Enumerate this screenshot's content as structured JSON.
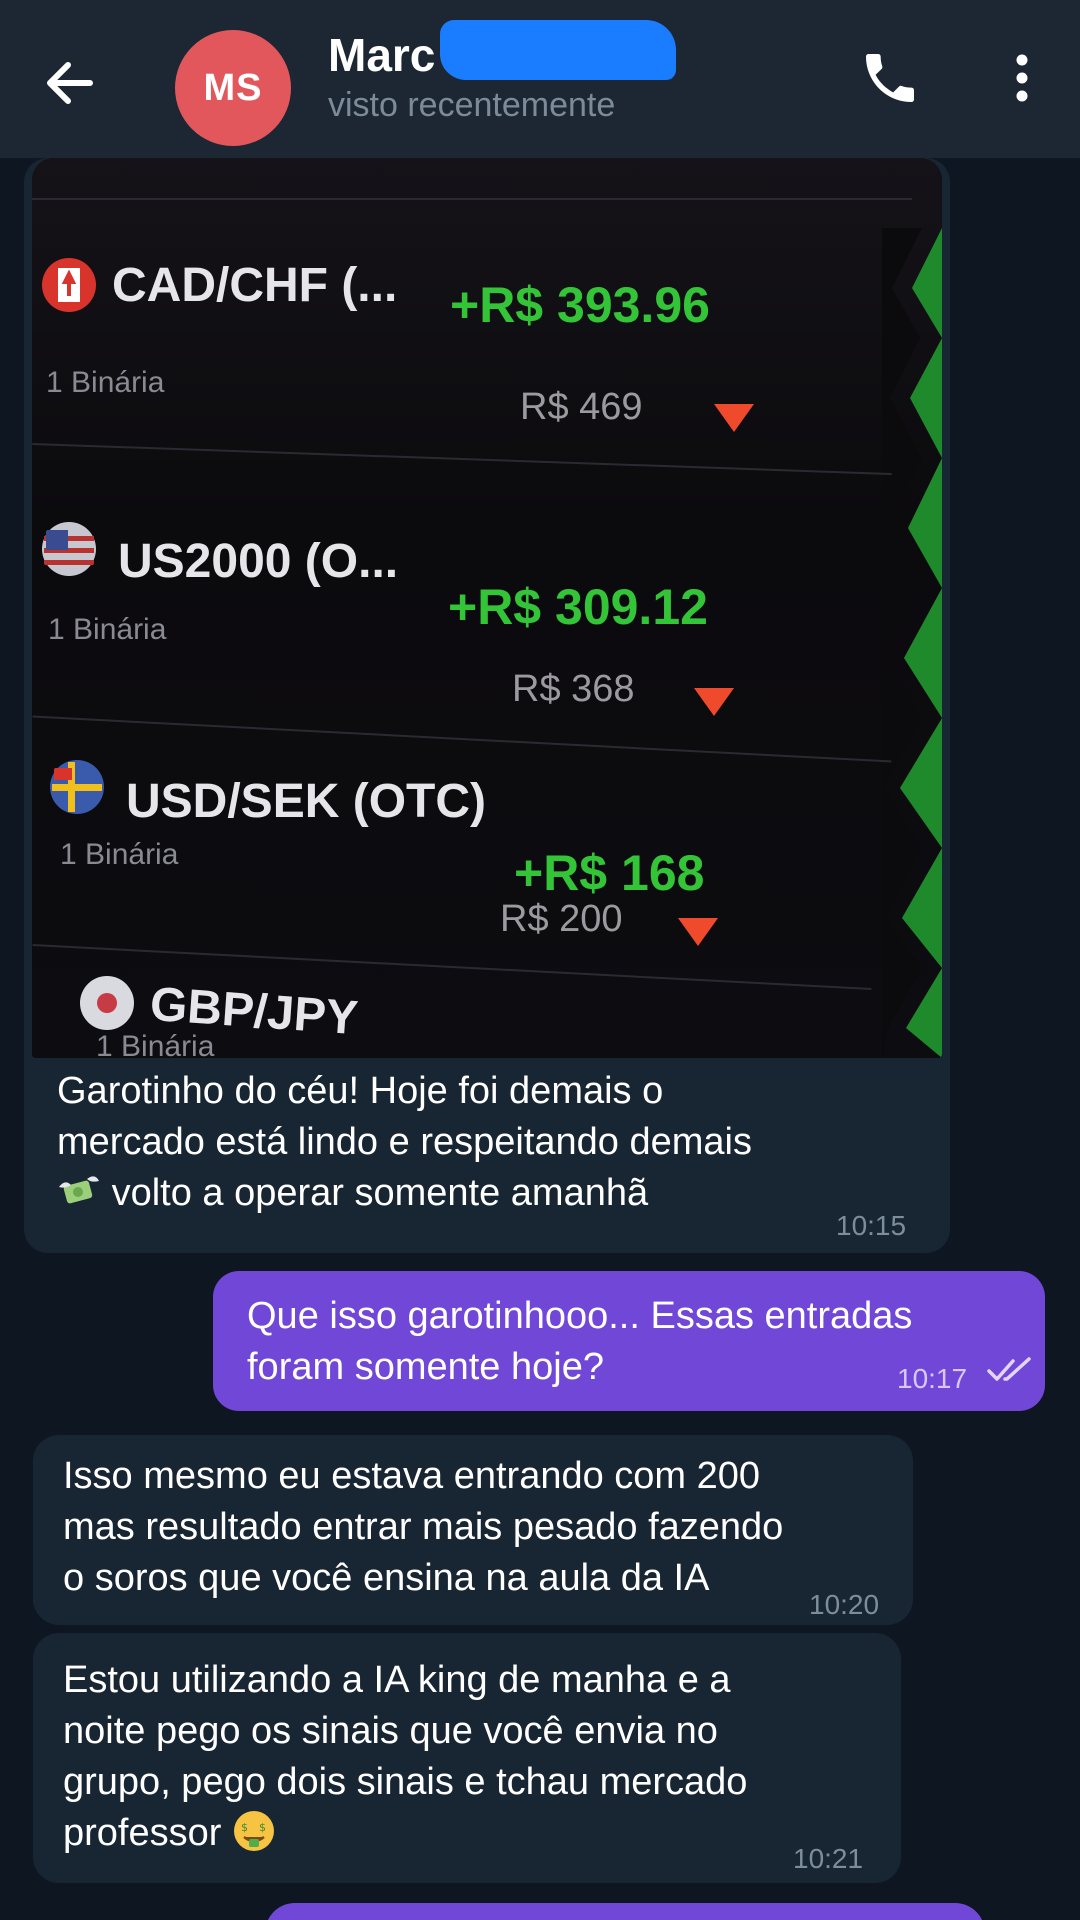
{
  "header": {
    "contact_name": "Marc",
    "status": "visto recentemente",
    "avatar_initials": "MS",
    "avatar_color": "#e2575c",
    "icons": [
      "arrow-back-icon",
      "phone-icon",
      "more-vertical-icon"
    ]
  },
  "photo": {
    "rows": [
      {
        "pair": "CAD/CHF (...",
        "type": "1 Binária",
        "profit": "+R$ 393.96",
        "stake": "R$ 469"
      },
      {
        "pair": "US2000 (O...",
        "type": "1 Binária",
        "profit": "+R$ 309.12",
        "stake": "R$ 368"
      },
      {
        "pair": "USD/SEK (OTC)",
        "type": "1 Binária",
        "profit": "+R$ 168",
        "stake": "R$ 200"
      },
      {
        "pair": "GBP/JPY",
        "type": "1 Binária"
      }
    ],
    "profit_color": "#34c437",
    "loss_color": "#f04a2c"
  },
  "messages": [
    {
      "direction": "incoming",
      "lines": [
        "Garotinho do céu! Hoje foi demais o",
        "mercado está lindo e respeitando demais",
        "volto a operar somente amanhã"
      ],
      "time": "10:15"
    },
    {
      "direction": "outgoing",
      "lines": [
        "Que isso garotinhooo... Essas entradas",
        "foram somente hoje?"
      ],
      "time": "10:17"
    },
    {
      "direction": "incoming",
      "lines": [
        "Isso mesmo eu estava entrando com 200",
        "mas resultado entrar mais pesado fazendo",
        "o soros que você ensina na aula da IA"
      ],
      "time": "10:20"
    },
    {
      "direction": "incoming",
      "lines": [
        "Estou utilizando a IA king de manha e a",
        "noite pego os sinais que você envia no",
        "grupo, pego dois sinais e tchau mercado",
        "professor"
      ],
      "time": "10:21"
    }
  ],
  "colors": {
    "background": "#0e1621",
    "header": "#1c2733",
    "incoming_bubble": "#182533",
    "outgoing_bubble": "#7147d8"
  }
}
